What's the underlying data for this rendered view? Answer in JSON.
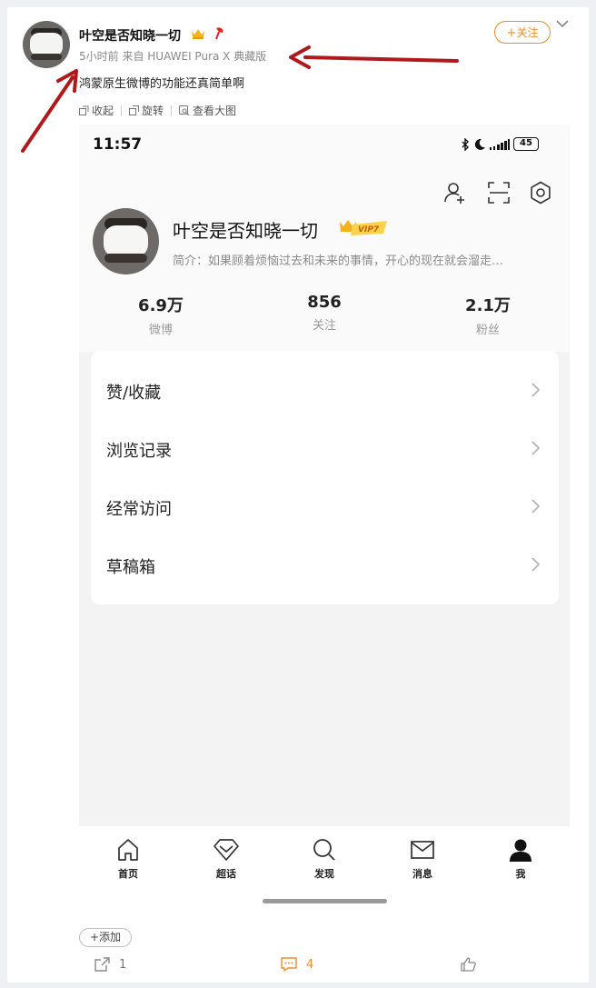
{
  "post": {
    "author": "叶空是否知晓一切",
    "meta": "5小时前  来自 HUAWEI Pura X 典藏版",
    "text": "鸿蒙原生微博的功能还真简单啊",
    "follow_label": "关注",
    "toolbar": {
      "collapse": "收起",
      "rotate": "旋转",
      "view_large": "查看大图"
    }
  },
  "phone": {
    "time": "11:57",
    "battery": "45",
    "profile": {
      "name": "叶空是否知晓一切",
      "vip": "VIP7",
      "bio": "简介：如果顾着烦恼过去和未来的事情，开心的现在就会溜走…"
    },
    "stats": [
      {
        "value": "6.9万",
        "label": "微博"
      },
      {
        "value": "856",
        "label": "关注"
      },
      {
        "value": "2.1万",
        "label": "粉丝"
      }
    ],
    "menu": [
      "赞/收藏",
      "浏览记录",
      "经常访问",
      "草稿箱"
    ],
    "tabs": [
      "首页",
      "超话",
      "发现",
      "消息",
      "我"
    ]
  },
  "footer": {
    "add_tag": "+添加",
    "repost_count": "1",
    "comment_count": "4"
  },
  "colors": {
    "accent": "#f08c28",
    "arrow": "#b0191c"
  }
}
